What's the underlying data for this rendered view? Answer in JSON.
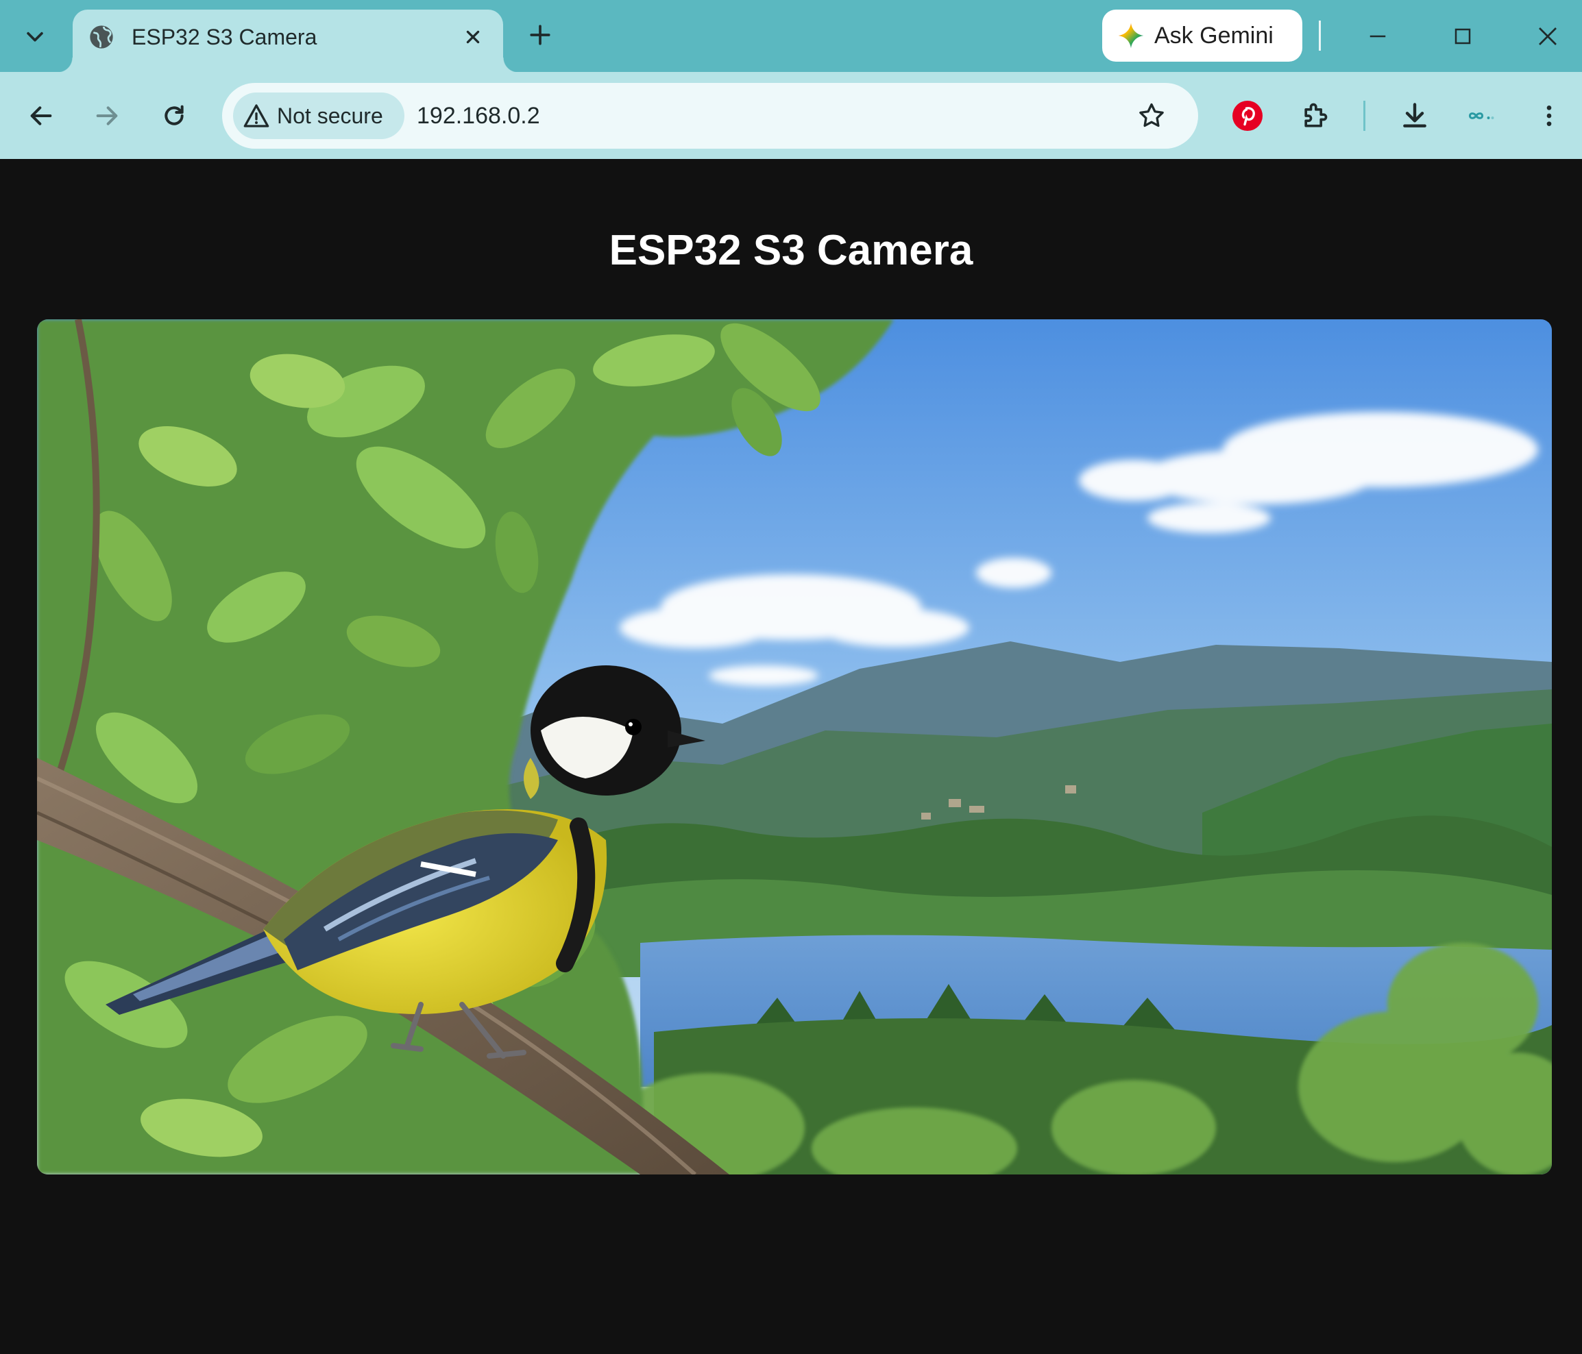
{
  "browser": {
    "tab": {
      "title": "ESP32 S3 Camera"
    },
    "gemini_label": "Ask Gemini",
    "security_label": "Not secure",
    "url": "192.168.0.2",
    "theme": {
      "frame": "#5bb8c0",
      "toolbar": "#b5e3e6",
      "omnibox": "#eef9fa"
    }
  },
  "page": {
    "title": "ESP32 S3 Camera",
    "background": "#111111"
  }
}
